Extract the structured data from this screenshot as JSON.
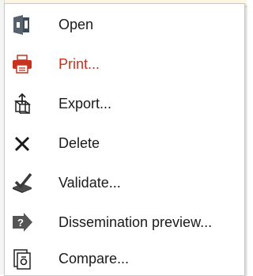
{
  "menu": {
    "items": [
      {
        "label": "Open",
        "icon": "open-icon"
      },
      {
        "label": "Print...",
        "icon": "print-icon",
        "color": "#c8321e"
      },
      {
        "label": "Export...",
        "icon": "export-icon"
      },
      {
        "label": "Delete",
        "icon": "delete-icon"
      },
      {
        "label": "Validate...",
        "icon": "validate-icon"
      },
      {
        "label": "Dissemination preview...",
        "icon": "dissemination-preview-icon"
      },
      {
        "label": "Compare...",
        "icon": "compare-icon"
      }
    ]
  }
}
